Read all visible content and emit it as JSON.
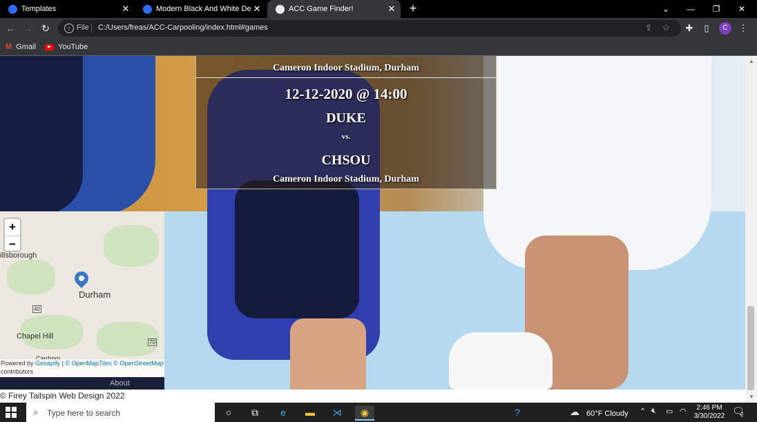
{
  "browser": {
    "tabs": [
      {
        "label": "Templates",
        "favicon_color": "#2d6df6",
        "active": false
      },
      {
        "label": "Modern Black And White Design",
        "favicon_color": "#2d6df6",
        "active": false
      },
      {
        "label": "ACC Game Finder!",
        "favicon_color": "#e8eaed",
        "active": true
      }
    ],
    "new_tab": "+",
    "window_controls": [
      "⌄",
      "—",
      "❐",
      "✕"
    ],
    "address": {
      "scheme": "File",
      "url": "C:/Users/freas/ACC-Carpooling/index.html#games"
    },
    "profile_initial": "C",
    "bookmarks": [
      {
        "label": "Gmail",
        "icon": "gmail-icon"
      },
      {
        "label": "YouTube",
        "icon": "youtube-icon"
      }
    ]
  },
  "games": {
    "previous_venue": "Cameron Indoor Stadium, Durham",
    "game": {
      "datetime": "12-12-2020 @ 14:00",
      "home": "DUKE",
      "vs": "vs.",
      "away": "CHSOU",
      "venue": "Cameron Indoor Stadium, Durham"
    }
  },
  "map": {
    "zoom_in": "+",
    "zoom_out": "−",
    "towns": [
      "illsborough",
      "Durham",
      "Chapel Hill",
      "Carrboro"
    ],
    "road_labels": [
      "40",
      "70"
    ],
    "attribution": {
      "prefix": "Powered by ",
      "geoapify": "Geoapify",
      "sep": " | ",
      "tiles": "© OpenMapTiles",
      "osm": "© OpenStreetMap",
      "suffix": "contributors"
    }
  },
  "nav": {
    "about": "About"
  },
  "footer": {
    "copyright": "© Firey Tailspin Web Design 2022"
  },
  "taskbar": {
    "search_placeholder": "Type here to search",
    "weather": "60°F  Cloudy",
    "time": "2:46 PM",
    "date": "3/30/2022",
    "notification_count": "2"
  }
}
